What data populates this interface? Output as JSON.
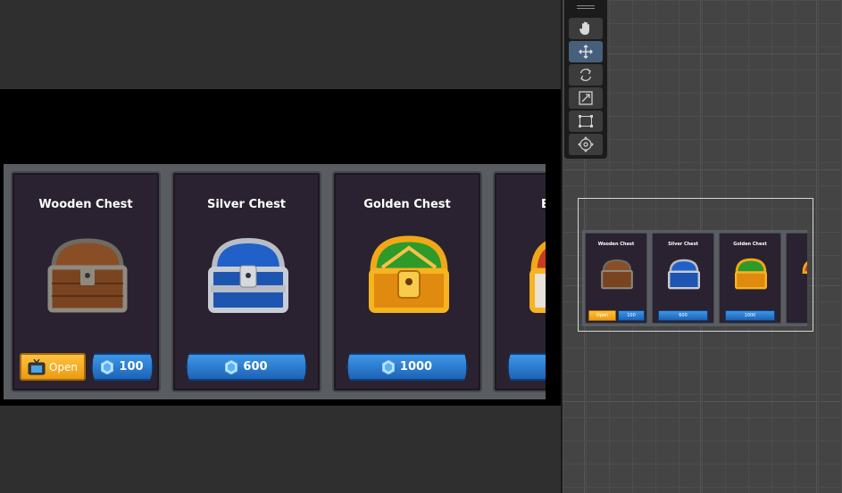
{
  "shop": {
    "cards": [
      {
        "title": "Wooden Chest",
        "open_label": "Open",
        "price": "100",
        "chest_icon": "wooden-chest-icon"
      },
      {
        "title": "Silver Chest",
        "price": "600",
        "chest_icon": "silver-chest-icon"
      },
      {
        "title": "Golden Chest",
        "price": "1000",
        "chest_icon": "golden-chest-icon"
      },
      {
        "title": "E",
        "chest_icon": "epic-chest-icon"
      }
    ],
    "currency_icon": "gem-icon",
    "ad_icon": "tv-icon"
  },
  "scene": {
    "cards": [
      {
        "title": "Wooden Chest",
        "open_label": "Open",
        "price": "100"
      },
      {
        "title": "Silver Chest",
        "price": "600"
      },
      {
        "title": "Golden Chest",
        "price": "1000"
      }
    ]
  },
  "toolbar": {
    "tools": [
      "hand-tool",
      "move-tool",
      "rotate-tool",
      "scale-tool",
      "rect-tool",
      "transform-tool"
    ],
    "active_tool": "move-tool"
  },
  "colors": {
    "card_bg": "#2a2230",
    "price_button": "#2a7fd4",
    "open_button": "#f5b02a",
    "wood": "#8a4e26",
    "silver": "#b8bcc4",
    "silver_blue": "#2060c8",
    "gold": "#f0a818",
    "gold_green": "#2d9a2a",
    "active_tool": "#46607c"
  }
}
